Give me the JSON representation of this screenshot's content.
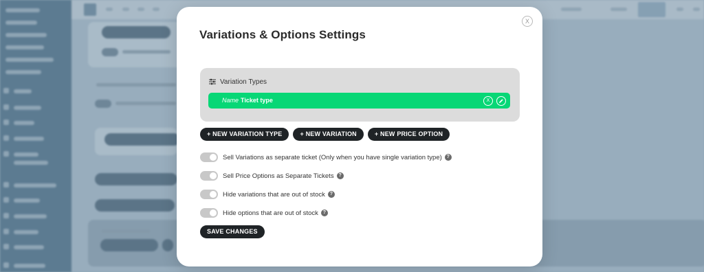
{
  "modal": {
    "title": "Variations & Options Settings",
    "close_label": "X"
  },
  "variation_types": {
    "header_icon": "sliders-icon",
    "label": "Variation Types",
    "rows": [
      {
        "name_label": "Name",
        "value": "Ticket type",
        "remove_label": "X",
        "edit_icon": "pencil-icon"
      }
    ]
  },
  "actions": {
    "new_variation_type": "+ NEW VARIATION TYPE",
    "new_variation": "+ NEW VARIATION",
    "new_price_option": "+ NEW PRICE OPTION"
  },
  "options": [
    {
      "label": "Sell Variations as separate ticket (Only when you have single variation type)",
      "help": "?",
      "enabled": false
    },
    {
      "label": "Sell Price Options as Separate Tickets",
      "help": "?",
      "enabled": false
    },
    {
      "label": "Hide variations that are out of stock",
      "help": "?",
      "enabled": false
    },
    {
      "label": "Hide options that are out of stock",
      "help": "?",
      "enabled": false
    }
  ],
  "save_label": "SAVE CHANGES",
  "colors": {
    "accent_green": "#08d776",
    "dark_button": "#1f2326",
    "overlay": "#8fa6b6"
  }
}
